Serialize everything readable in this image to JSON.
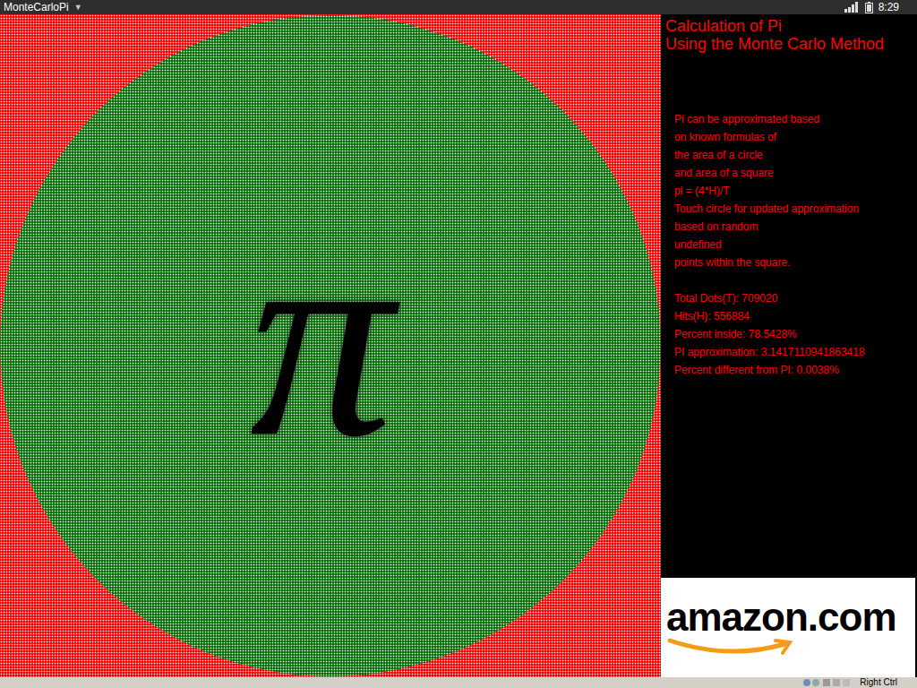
{
  "window": {
    "title": "MonteCarloPi",
    "menu_icon": "▼",
    "time": "8:29"
  },
  "canvas": {
    "symbol": "π"
  },
  "panel": {
    "title": [
      "Calculation of Pi",
      "Using the Monte Carlo Method"
    ],
    "description": [
      "Pi can be approximated based",
      "on known formulas of",
      "the area of a circle",
      "and area of a square",
      "pi = (4*H)/T",
      "Touch circle for updated approximation",
      "based on random",
      "undefined",
      "points within the square."
    ],
    "stats": [
      "Total Dots(T): 709020",
      "Hits(H): 556884",
      "Percent inside: 78.5428%",
      "PI approximation: 3.1417110941863418",
      "Percent different from PI: 0.0038%"
    ]
  },
  "ad": {
    "text": "amazon.com"
  },
  "host_bar": {
    "key": "Right Ctrl"
  }
}
